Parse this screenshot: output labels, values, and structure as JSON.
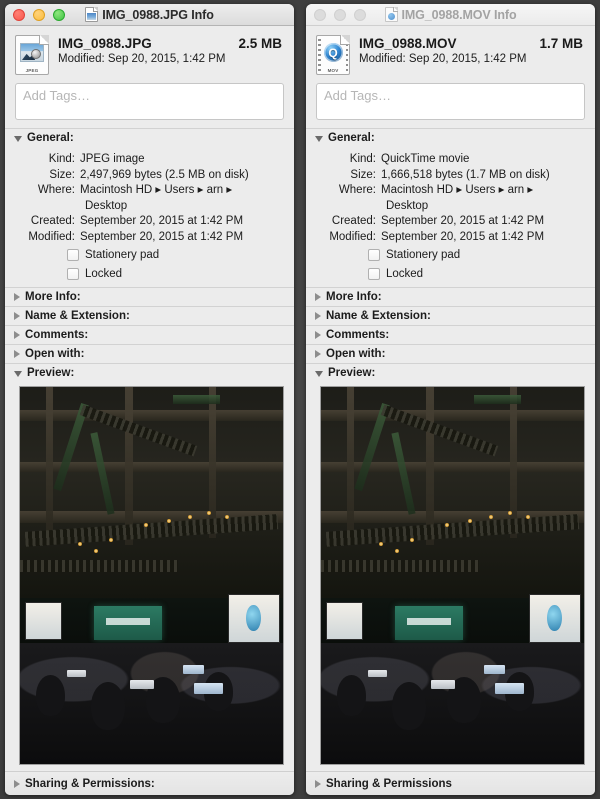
{
  "desktop": {
    "background": "#434343"
  },
  "windows": [
    {
      "id": "jpg",
      "active": true,
      "title": "IMG_0988.JPG Info",
      "titlebar_icon": "jpeg-document-icon",
      "file": {
        "icon": "jpeg-file-icon",
        "icon_badge": "JPEG",
        "name": "IMG_0988.JPG",
        "size": "2.5 MB",
        "modified_label": "Modified:",
        "modified_value": "Sep 20, 2015, 1:42 PM"
      },
      "tags": {
        "placeholder": "Add Tags…",
        "value": ""
      },
      "general": {
        "title": "General:",
        "expanded": true,
        "rows": [
          {
            "label": "Kind:",
            "value": "JPEG image"
          },
          {
            "label": "Size:",
            "value": "2,497,969 bytes (2.5 MB on disk)"
          },
          {
            "label": "Where:",
            "value": "Macintosh HD ▸ Users ▸ arn ▸",
            "continuation": "Desktop"
          },
          {
            "label": "Created:",
            "value": "September 20, 2015 at 1:42 PM"
          },
          {
            "label": "Modified:",
            "value": "September 20, 2015 at 1:42 PM"
          }
        ],
        "checkboxes": [
          {
            "label": "Stationery pad",
            "checked": false
          },
          {
            "label": "Locked",
            "checked": false
          }
        ]
      },
      "sections": [
        {
          "title": "More Info:",
          "expanded": false
        },
        {
          "title": "Name & Extension:",
          "expanded": false
        },
        {
          "title": "Comments:",
          "expanded": false
        },
        {
          "title": "Open with:",
          "expanded": false
        }
      ],
      "preview": {
        "title": "Preview:",
        "expanded": true
      },
      "footer": {
        "title": "Sharing & Permissions:",
        "expanded": false
      }
    },
    {
      "id": "mov",
      "active": false,
      "title": "IMG_0988.MOV Info",
      "titlebar_icon": "quicktime-document-icon",
      "file": {
        "icon": "quicktime-file-icon",
        "icon_badge": "MOV",
        "name": "IMG_0988.MOV",
        "size": "1.7 MB",
        "modified_label": "Modified:",
        "modified_value": "Sep 20, 2015, 1:42 PM"
      },
      "tags": {
        "placeholder": "Add Tags…",
        "value": ""
      },
      "general": {
        "title": "General:",
        "expanded": true,
        "rows": [
          {
            "label": "Kind:",
            "value": "QuickTime movie"
          },
          {
            "label": "Size:",
            "value": "1,666,518 bytes (1.7 MB on disk)"
          },
          {
            "label": "Where:",
            "value": "Macintosh HD ▸ Users ▸ arn ▸",
            "continuation": "Desktop"
          },
          {
            "label": "Created:",
            "value": "September 20, 2015 at 1:42 PM"
          },
          {
            "label": "Modified:",
            "value": "September 20, 2015 at 1:42 PM"
          }
        ],
        "checkboxes": [
          {
            "label": "Stationery pad",
            "checked": false
          },
          {
            "label": "Locked",
            "checked": false
          }
        ]
      },
      "sections": [
        {
          "title": "More Info:",
          "expanded": false
        },
        {
          "title": "Name & Extension:",
          "expanded": false
        },
        {
          "title": "Comments:",
          "expanded": false
        },
        {
          "title": "Open with:",
          "expanded": false
        }
      ],
      "preview": {
        "title": "Preview:",
        "expanded": true
      },
      "footer": {
        "title": "Sharing & Permissions",
        "expanded": false
      }
    }
  ]
}
